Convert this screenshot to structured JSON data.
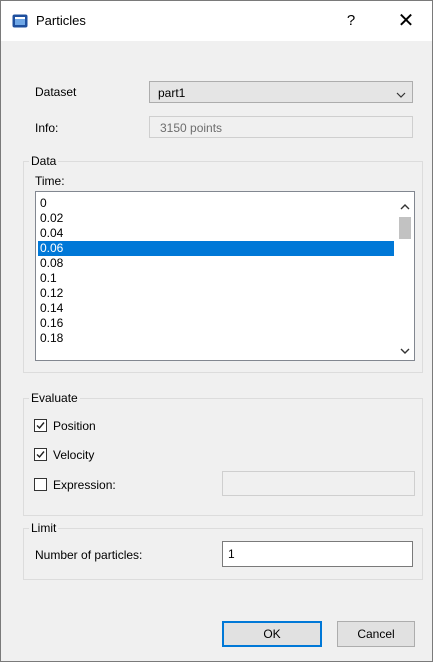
{
  "window": {
    "title": "Particles",
    "help_label": "?",
    "close_label": "✕",
    "icon": "app-window-icon"
  },
  "dataset": {
    "label": "Dataset",
    "value": "part1",
    "icon": "chevron-down-icon"
  },
  "info": {
    "label": "Info:",
    "value": "3150 points"
  },
  "data_group": {
    "title": "Data",
    "time_label": "Time:",
    "time_values": [
      "0",
      "0.02",
      "0.04",
      "0.06",
      "0.08",
      "0.1",
      "0.12",
      "0.14",
      "0.16",
      "0.18"
    ],
    "selected": "0.06"
  },
  "evaluate_group": {
    "title": "Evaluate",
    "position": {
      "label": "Position",
      "checked": true
    },
    "velocity": {
      "label": "Velocity",
      "checked": true
    },
    "expression": {
      "label": "Expression:",
      "checked": false,
      "value": ""
    }
  },
  "limit_group": {
    "title": "Limit",
    "particles_label": "Number of particles:",
    "particles_value": "1"
  },
  "buttons": {
    "ok": "OK",
    "cancel": "Cancel"
  },
  "colors": {
    "selection": "#0078d7",
    "dialog_bg": "#f0f0f0",
    "default_button_border": "#0078d7"
  }
}
